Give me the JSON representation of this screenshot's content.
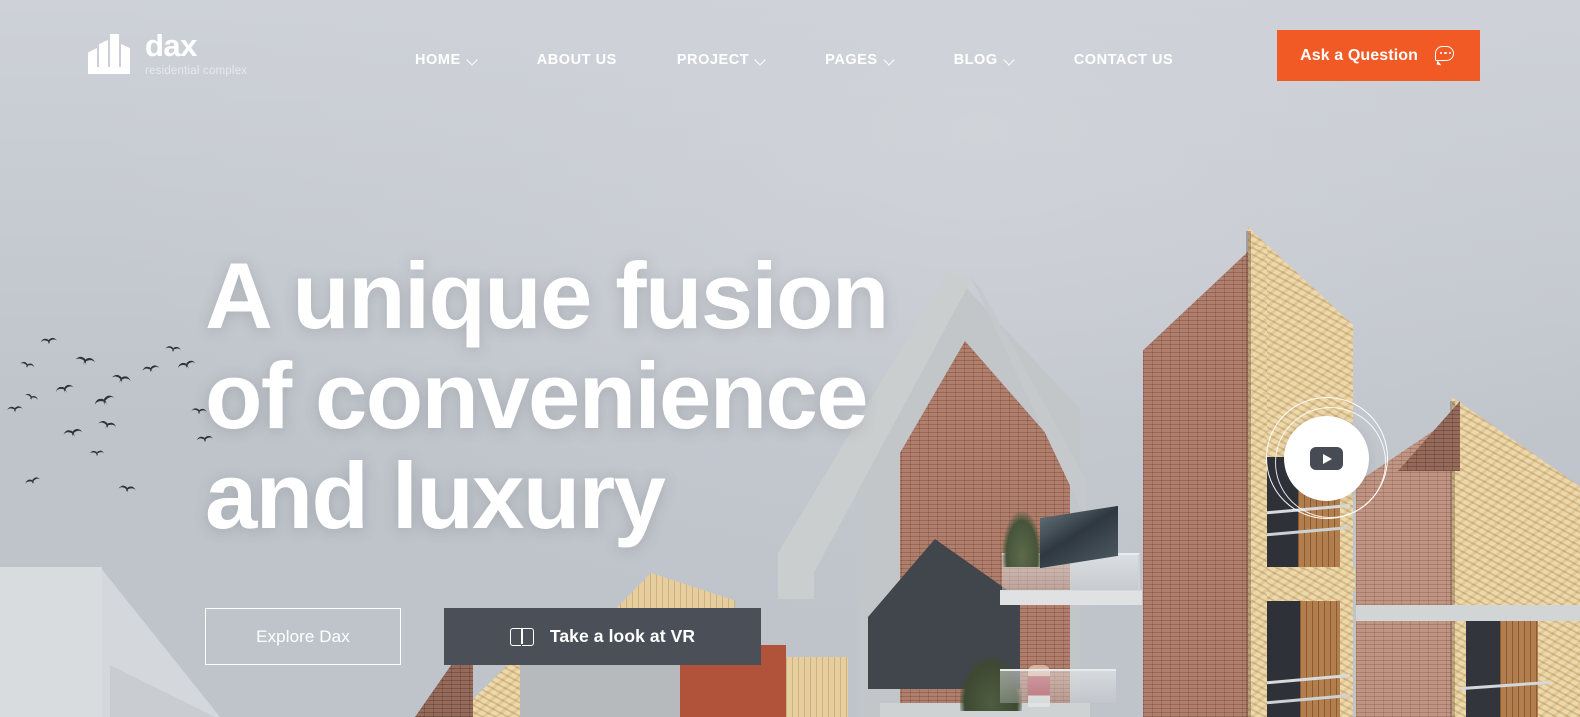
{
  "site": {
    "logo": {
      "name": "dax",
      "tagline": "residential complex",
      "icon": "building-logo-icon"
    },
    "accent_color": "#f15a24",
    "dark_button_color": "#4b5058",
    "sky_color": "#c6cad0"
  },
  "nav": {
    "items": [
      {
        "label": "HOME",
        "has_dropdown": true,
        "icon": "chevron-down-icon"
      },
      {
        "label": "ABOUT US",
        "has_dropdown": false,
        "icon": ""
      },
      {
        "label": "PROJECT",
        "has_dropdown": true,
        "icon": "chevron-down-icon"
      },
      {
        "label": "PAGES",
        "has_dropdown": true,
        "icon": "chevron-down-icon"
      },
      {
        "label": "BLOG",
        "has_dropdown": true,
        "icon": "chevron-down-icon"
      },
      {
        "label": "CONTACT US",
        "has_dropdown": false,
        "icon": ""
      }
    ]
  },
  "header_cta": {
    "label": "Ask a Question",
    "icon": "chat-bubble-icon"
  },
  "hero": {
    "headline_line1": "A unique fusion",
    "headline_line2": "of convenience",
    "headline_line3": "and luxury",
    "primary_button": {
      "label": "Explore Dax"
    },
    "secondary_button": {
      "label": "Take a look at VR",
      "icon": "open-book-icon"
    },
    "video": {
      "icon": "play-button-icon"
    }
  }
}
